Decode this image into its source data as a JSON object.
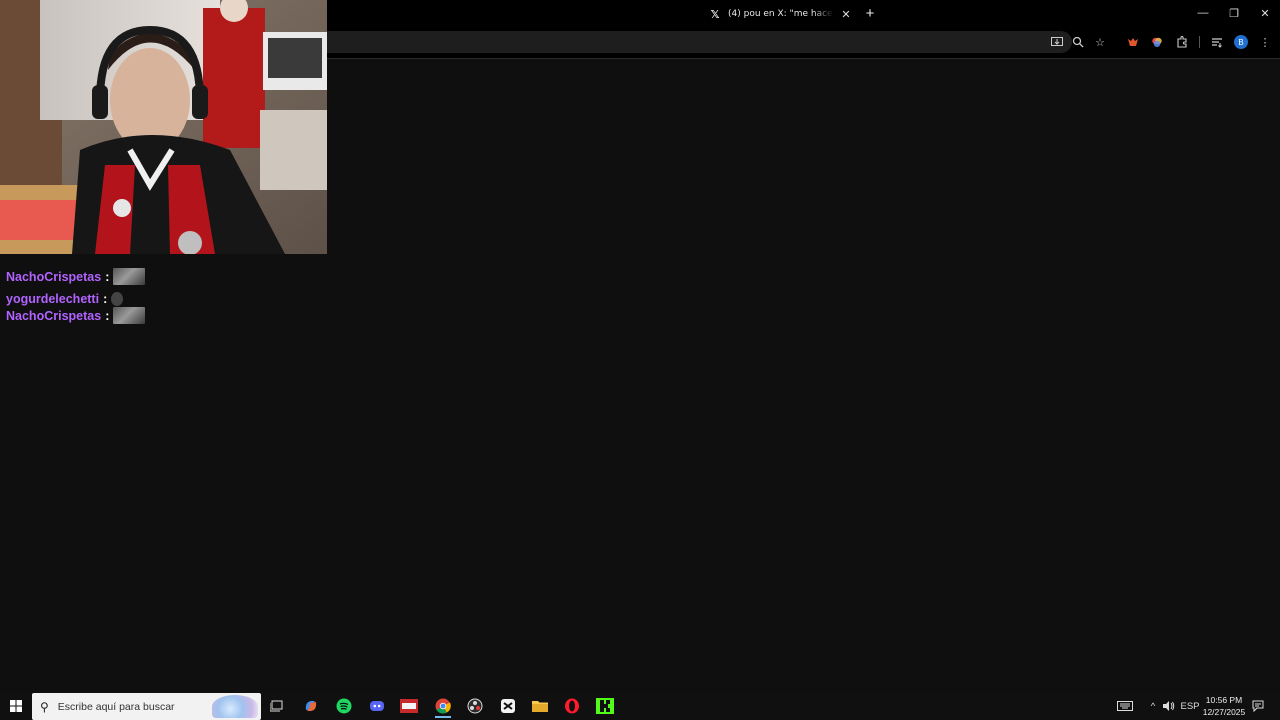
{
  "browser": {
    "tab": {
      "title": "(4) pou en X: \"me hace refle",
      "icon": "x-logo-icon"
    },
    "toolbar_icons": [
      "install-app-icon",
      "zoom-icon",
      "bookmark-star-icon",
      "extension-fox-icon",
      "extension-color-icon",
      "extensions-puzzle-icon",
      "reading-list-icon",
      "profile-avatar-icon",
      "menu-dots-icon"
    ],
    "profile_initial": "B"
  },
  "chat": {
    "messages": [
      {
        "user": "NachoCrispetas",
        "sep": ":"
      },
      {
        "user": "yogurdelechetti",
        "sep": ":"
      },
      {
        "user": "NachoCrispetas",
        "sep": ":"
      }
    ],
    "username_color": "#b263ff"
  },
  "taskbar": {
    "search_placeholder": "Escribe aquí para buscar",
    "language": "ESP",
    "time": "10:56 PM",
    "date": "12/27/2025",
    "apps": [
      "task-view-icon",
      "copilot-icon",
      "spotify-icon",
      "discord-icon",
      "game-app-icon",
      "chrome-icon",
      "obs-icon",
      "capcut-icon",
      "file-explorer-icon",
      "opera-icon",
      "kick-icon"
    ]
  },
  "colors": {
    "page_background": "#0f0f0f",
    "taskbar_background": "#101010",
    "accent_underline": "#76b9ed"
  }
}
